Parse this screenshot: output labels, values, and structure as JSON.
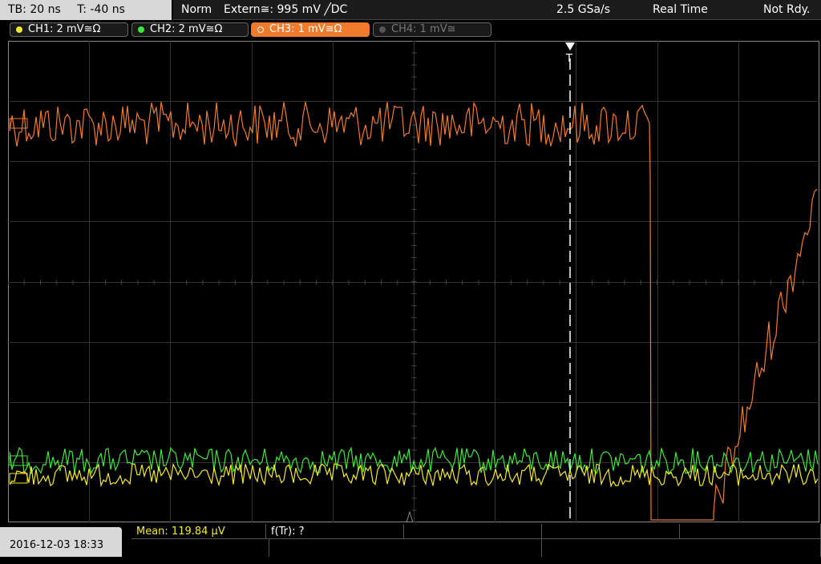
{
  "header": {
    "timebase": "TB: 20 ns",
    "trigger_offset": "T: -40 ns",
    "trigger_mode": "Norm",
    "trigger_source": "Extern≅: 995 mV ╱DC",
    "sample_rate": "2.5 GSa/s",
    "acq_mode": "Real Time",
    "status": "Not Rdy."
  },
  "channels": [
    {
      "label": "CH1: 2 mV≅Ω",
      "color": "#f4ea2a",
      "active": true
    },
    {
      "label": "CH2: 2 mV≅Ω",
      "color": "#3ee83a",
      "active": true
    },
    {
      "label": "CH3: 1 mV≅Ω",
      "color": "#f07b2c",
      "active": true
    },
    {
      "label": "CH4: 1 mV≅",
      "color": "#666666",
      "active": false
    }
  ],
  "trigger_marker": "T",
  "measurements": {
    "mean": "Mean: 119.84 µV",
    "freq": "f(Tr): ?"
  },
  "datetime": "2016-12-03 18:33",
  "colors": {
    "ch1": "#f4ea2a",
    "ch2": "#3ee83a",
    "ch3": "#f07b2c",
    "grid": "#3a3a3a"
  }
}
